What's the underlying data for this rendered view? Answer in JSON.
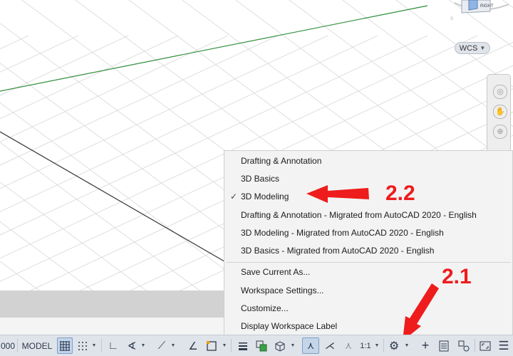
{
  "viewport": {
    "viewcube_face_label": "RIGHT",
    "ucs_badge": "WCS"
  },
  "workspace_menu": {
    "items": [
      {
        "label": "Drafting & Annotation",
        "checked": false
      },
      {
        "label": "3D Basics",
        "checked": false
      },
      {
        "label": "3D Modeling",
        "checked": true
      },
      {
        "label": "Drafting & Annotation - Migrated from AutoCAD 2020 - English",
        "checked": false
      },
      {
        "label": "3D Modeling - Migrated from AutoCAD 2020 - English",
        "checked": false
      },
      {
        "label": "3D Basics - Migrated from AutoCAD 2020 - English",
        "checked": false
      }
    ],
    "commands": [
      "Save Current As...",
      "Workspace Settings...",
      "Customize...",
      "Display Workspace Label"
    ],
    "check_glyph": "✓"
  },
  "annotations": {
    "step_select": "2.2",
    "step_gear": "2.1",
    "arrow_color": "#ee1c1c"
  },
  "statusbar": {
    "coords_fragment": "000",
    "model_label": "MODEL",
    "annotation_scale": "1:1"
  }
}
